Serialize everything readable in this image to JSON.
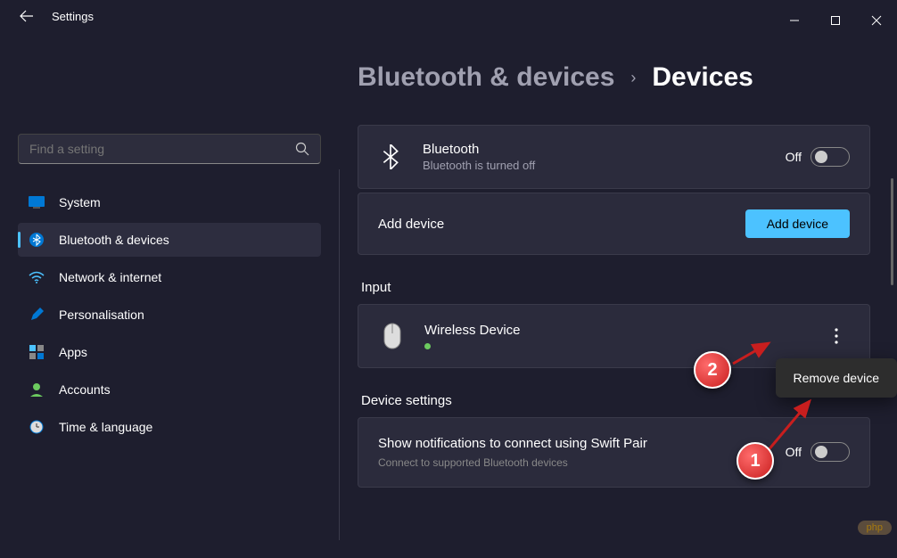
{
  "window": {
    "app_title": "Settings"
  },
  "search": {
    "placeholder": "Find a setting"
  },
  "sidebar": {
    "items": [
      {
        "label": "System",
        "icon": "system"
      },
      {
        "label": "Bluetooth & devices",
        "icon": "bluetooth",
        "active": true
      },
      {
        "label": "Network & internet",
        "icon": "network"
      },
      {
        "label": "Personalisation",
        "icon": "personalisation"
      },
      {
        "label": "Apps",
        "icon": "apps"
      },
      {
        "label": "Accounts",
        "icon": "accounts"
      },
      {
        "label": "Time & language",
        "icon": "time"
      }
    ]
  },
  "breadcrumb": {
    "parent": "Bluetooth & devices",
    "current": "Devices"
  },
  "bluetooth_card": {
    "title": "Bluetooth",
    "subtitle": "Bluetooth is turned off",
    "toggle_label": "Off"
  },
  "add_device": {
    "label": "Add device",
    "button": "Add device"
  },
  "sections": {
    "input": "Input",
    "device_settings": "Device settings"
  },
  "input_device": {
    "name": "Wireless Device"
  },
  "context_menu": {
    "remove": "Remove device"
  },
  "swift_pair": {
    "title": "Show notifications to connect using Swift Pair",
    "subtitle": "Connect to supported Bluetooth devices",
    "toggle_label": "Off"
  },
  "annotations": {
    "one": "1",
    "two": "2"
  },
  "watermark": "php"
}
